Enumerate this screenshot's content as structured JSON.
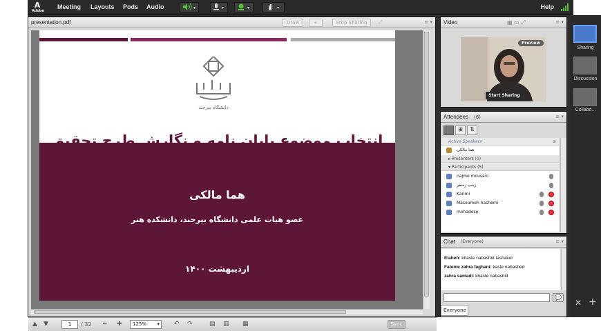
{
  "menubar": {
    "logo_text": "A",
    "logo_sub": "Adobe",
    "items": [
      "Meeting",
      "Layouts",
      "Pods",
      "Audio"
    ],
    "help": "Help"
  },
  "share_pod": {
    "title": "presentation.pdf",
    "buttons": {
      "draw": "Draw",
      "stop_sharing": "Stop Sharing"
    },
    "slide": {
      "logo_caption": "دانشگاه بیرجند",
      "title": "انتخاب موضوع پایان نامه و نگارش طرح تحقیق",
      "name": "هما مالکی",
      "subtitle": "عضو هیات علمی دانشگاه بیرجند، دانشکده هنر",
      "date": "اردیبهشت ۱۴۰۰"
    },
    "footer": {
      "page": "1",
      "page_total": "/ 32",
      "zoom": "125%",
      "sync": "Sync"
    }
  },
  "video_pod": {
    "title": "Video",
    "preview": "Preview",
    "start_sharing": "Start Sharing"
  },
  "attendees_pod": {
    "title": "Attendees",
    "count": "(6)",
    "active_speakers": "Active Speakers",
    "host_name": "هما مالکی",
    "presenters": "Presenters (0)",
    "participants": "Participants (5)",
    "participant_names": [
      "najme mousavi",
      "زینب رسفر",
      "Karimi",
      "Masoumeh hashemi",
      "mohadese"
    ]
  },
  "chat_pod": {
    "title": "Chat",
    "scope": "(Everyone)",
    "messages": [
      {
        "sender": "Elaheh:",
        "text": "khaste nabashid tashakor"
      },
      {
        "sender": "Fateme zahra faghani:",
        "text": "kaste nabashed"
      },
      {
        "sender": "zahra samadi:",
        "text": "khaste nabashid"
      }
    ],
    "tab": "Everyone"
  },
  "layouts": {
    "items": [
      "Sharing",
      "Discussion",
      "Collabo..."
    ]
  },
  "colors": {
    "maroon": "#5e1638",
    "bar_pink": "#8a2a5c",
    "bar_gray": "#aaaaaa"
  }
}
